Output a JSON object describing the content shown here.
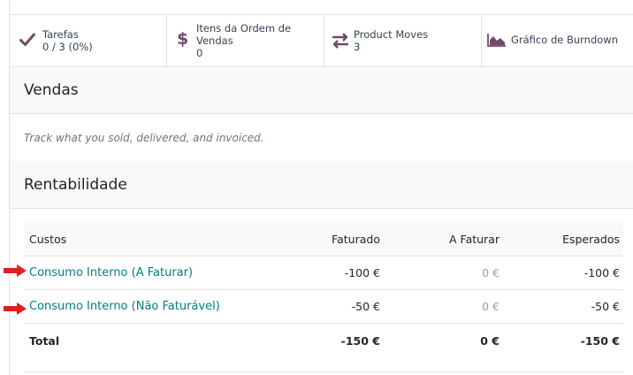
{
  "stat_buttons": [
    {
      "label": "Tarefas",
      "value": "0 / 3 (0%)",
      "icon": "check-icon"
    },
    {
      "label_line1": "Itens da Ordem de",
      "label_line2": "Vendas",
      "value": "0",
      "icon": "dollar-icon"
    },
    {
      "label": "Product Moves",
      "value": "3",
      "icon": "transfer-arrows-icon"
    },
    {
      "label": "Gráfico de Burndown",
      "icon": "area-chart-icon"
    }
  ],
  "sections": {
    "sales_title": "Vendas",
    "sales_note": "Track what you sold, delivered, and invoiced.",
    "profit_title": "Rentabilidade"
  },
  "table": {
    "headers": [
      "Custos",
      "Faturado",
      "A Faturar",
      "Esperados"
    ],
    "rows": [
      {
        "label": "Consumo Interno (A Faturar)",
        "invoiced": "-100 €",
        "to_invoice": "0 €",
        "expected": "-100 €"
      },
      {
        "label": "Consumo Interno (Não Faturável)",
        "invoiced": "-50 €",
        "to_invoice": "0 €",
        "expected": "-50 €"
      }
    ],
    "total": {
      "label": "Total",
      "invoiced": "-150 €",
      "to_invoice": "0 €",
      "expected": "-150 €"
    }
  },
  "colors": {
    "accent": "#714b67",
    "link": "#017e84",
    "annotation_arrow": "#e02020"
  }
}
